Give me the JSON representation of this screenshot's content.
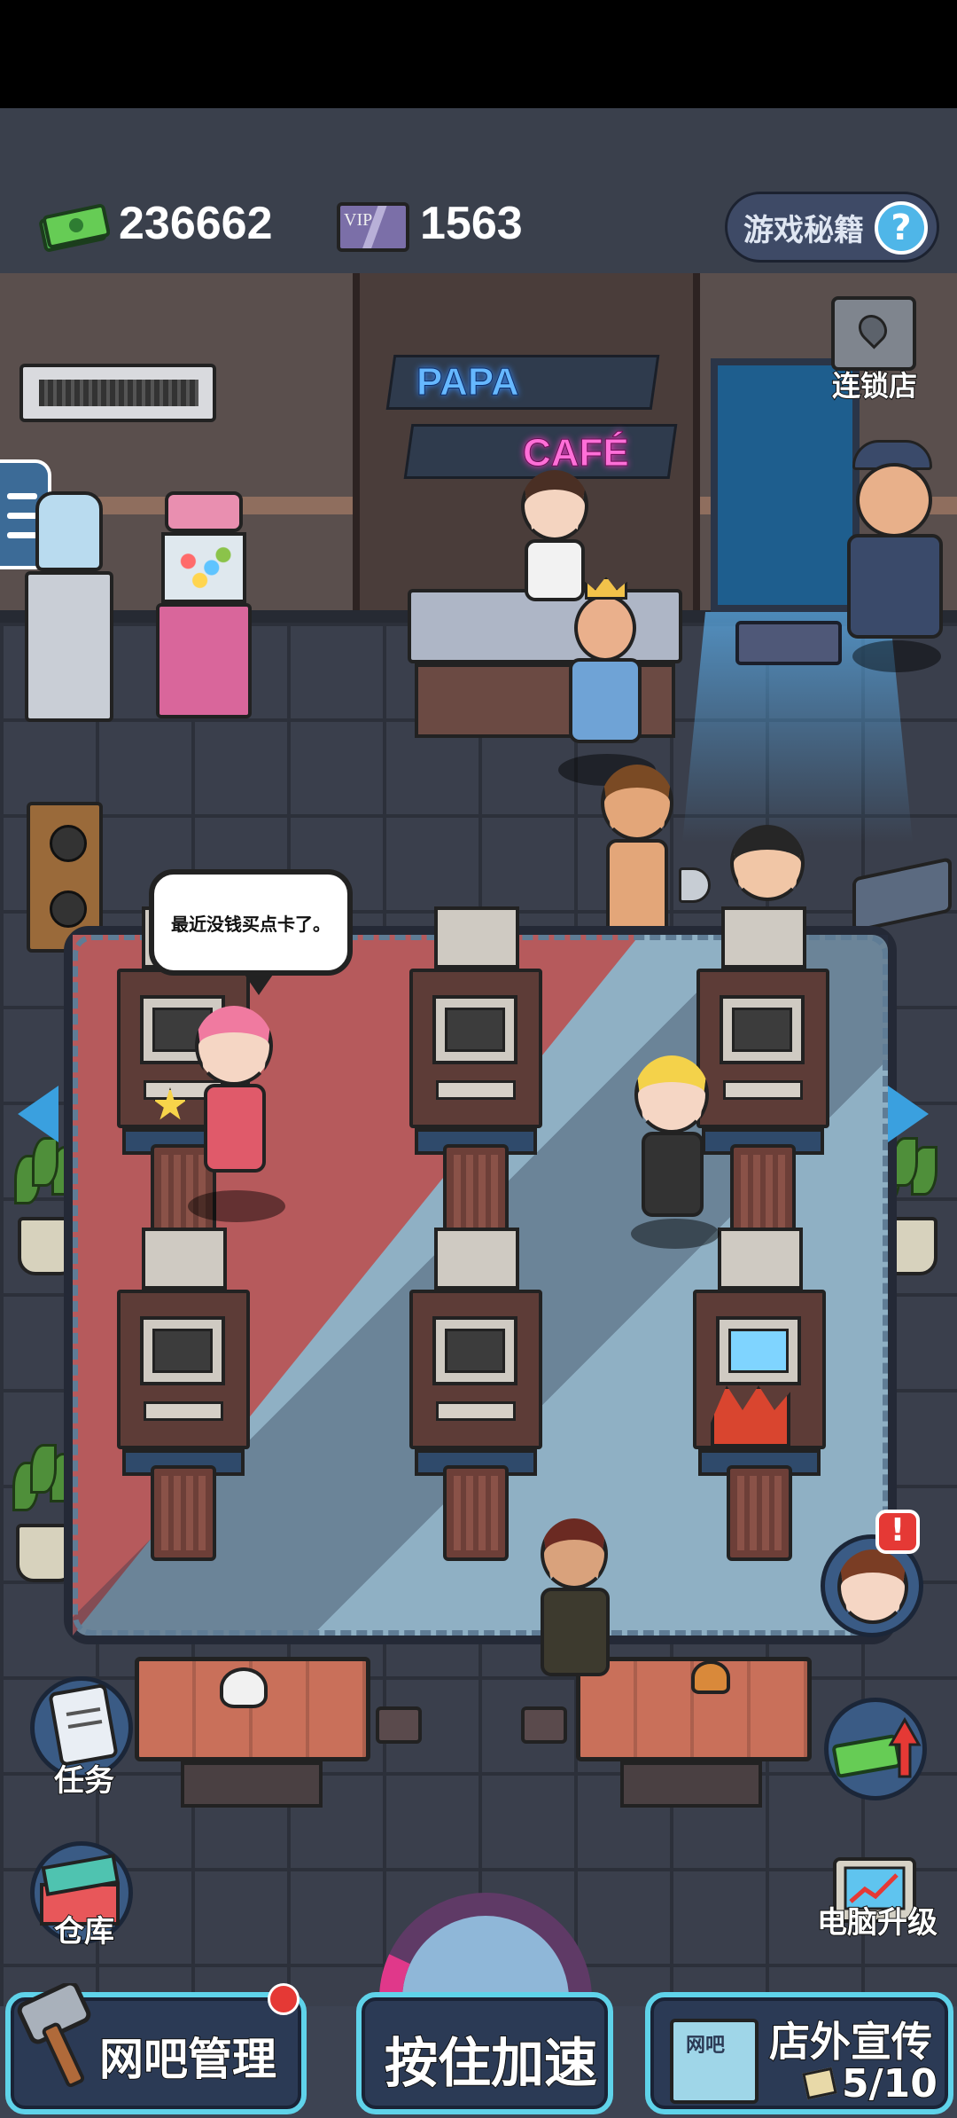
{
  "hud": {
    "money_value": "236662",
    "vip_label": "VIP",
    "vip_value": "1563",
    "cheats_label": "游戏秘籍",
    "cheats_icon": "?"
  },
  "sign": {
    "line1": "PAPA",
    "line2": "CAFÉ"
  },
  "chain_store_label": "连锁店",
  "speech_bubble": "最近没钱买点卡了。",
  "side_buttons": {
    "tasks": "任务",
    "warehouse": "仓库",
    "pc_upgrade": "电脑升级",
    "alert_badge": "!"
  },
  "bottom_bar": {
    "manage_label": "网吧管理",
    "speedup_label": "按住加速",
    "promo_label": "店外宣传",
    "promo_sign": "网吧",
    "promo_count": "5/10"
  },
  "colors": {
    "accent_cyan": "#5fd3ea",
    "arrow_blue": "#3aa0df",
    "alert_red": "#e53935",
    "money_green": "#5fbf4a"
  }
}
